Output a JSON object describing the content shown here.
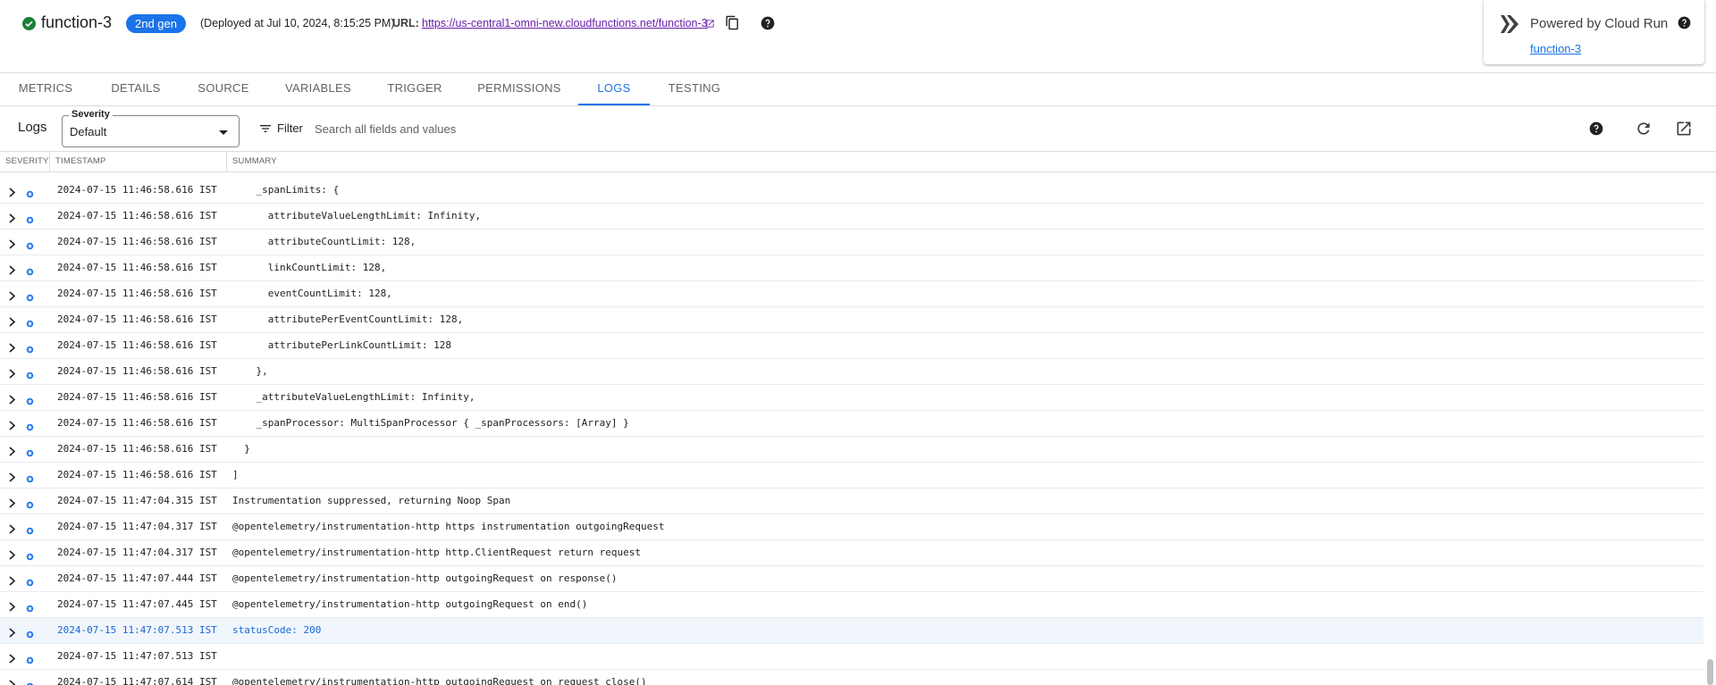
{
  "header": {
    "function_name": "function-3",
    "gen_badge": "2nd gen",
    "deployed": "(Deployed at Jul 10, 2024, 8:15:25 PM)",
    "url_label": "URL:",
    "url": "https://us-central1-omni-new.cloudfunctions.net/function-3"
  },
  "cloud_run": {
    "title": "Powered by Cloud Run",
    "link": "function-3"
  },
  "tabs": [
    {
      "label": "METRICS",
      "active": false
    },
    {
      "label": "DETAILS",
      "active": false
    },
    {
      "label": "SOURCE",
      "active": false
    },
    {
      "label": "VARIABLES",
      "active": false
    },
    {
      "label": "TRIGGER",
      "active": false
    },
    {
      "label": "PERMISSIONS",
      "active": false
    },
    {
      "label": "LOGS",
      "active": true
    },
    {
      "label": "TESTING",
      "active": false
    }
  ],
  "toolbar": {
    "title": "Logs",
    "severity_label": "Severity",
    "severity_value": "Default",
    "filter_label": "Filter",
    "search_placeholder": "Search all fields and values"
  },
  "table": {
    "columns": {
      "severity": "SEVERITY",
      "timestamp": "TIMESTAMP",
      "summary": "SUMMARY"
    },
    "rows": [
      {
        "ts": "2024-07-15 11:46:58.616 IST",
        "msg": "    _spanLimits: {",
        "highlight": false
      },
      {
        "ts": "2024-07-15 11:46:58.616 IST",
        "msg": "      attributeValueLengthLimit: Infinity,",
        "highlight": false
      },
      {
        "ts": "2024-07-15 11:46:58.616 IST",
        "msg": "      attributeCountLimit: 128,",
        "highlight": false
      },
      {
        "ts": "2024-07-15 11:46:58.616 IST",
        "msg": "      linkCountLimit: 128,",
        "highlight": false
      },
      {
        "ts": "2024-07-15 11:46:58.616 IST",
        "msg": "      eventCountLimit: 128,",
        "highlight": false
      },
      {
        "ts": "2024-07-15 11:46:58.616 IST",
        "msg": "      attributePerEventCountLimit: 128,",
        "highlight": false
      },
      {
        "ts": "2024-07-15 11:46:58.616 IST",
        "msg": "      attributePerLinkCountLimit: 128",
        "highlight": false
      },
      {
        "ts": "2024-07-15 11:46:58.616 IST",
        "msg": "    },",
        "highlight": false
      },
      {
        "ts": "2024-07-15 11:46:58.616 IST",
        "msg": "    _attributeValueLengthLimit: Infinity,",
        "highlight": false
      },
      {
        "ts": "2024-07-15 11:46:58.616 IST",
        "msg": "    _spanProcessor: MultiSpanProcessor { _spanProcessors: [Array] }",
        "highlight": false
      },
      {
        "ts": "2024-07-15 11:46:58.616 IST",
        "msg": "  }",
        "highlight": false
      },
      {
        "ts": "2024-07-15 11:46:58.616 IST",
        "msg": "]",
        "highlight": false
      },
      {
        "ts": "2024-07-15 11:47:04.315 IST",
        "msg": "Instrumentation suppressed, returning Noop Span",
        "highlight": false
      },
      {
        "ts": "2024-07-15 11:47:04.317 IST",
        "msg": "@opentelemetry/instrumentation-http https instrumentation outgoingRequest",
        "highlight": false
      },
      {
        "ts": "2024-07-15 11:47:04.317 IST",
        "msg": "@opentelemetry/instrumentation-http http.ClientRequest return request",
        "highlight": false
      },
      {
        "ts": "2024-07-15 11:47:07.444 IST",
        "msg": "@opentelemetry/instrumentation-http outgoingRequest on response()",
        "highlight": false
      },
      {
        "ts": "2024-07-15 11:47:07.445 IST",
        "msg": "@opentelemetry/instrumentation-http outgoingRequest on end()",
        "highlight": false
      },
      {
        "ts": "2024-07-15 11:47:07.513 IST",
        "msg": "statusCode: 200",
        "highlight": true
      },
      {
        "ts": "2024-07-15 11:47:07.513 IST",
        "msg": "",
        "highlight": false
      },
      {
        "ts": "2024-07-15 11:47:07.614 IST",
        "msg": "@opentelemetry/instrumentation-http outgoingRequest on request close()",
        "highlight": false
      }
    ]
  },
  "colors": {
    "accent": "#1a73e8",
    "success": "#188038",
    "link_visited": "#681da8",
    "severity_default": "#1a73e8"
  },
  "icons": {
    "status": "check-circle-icon",
    "external": "open-in-new-icon",
    "copy": "copy-icon",
    "help": "help-icon",
    "cloud_run": "cloud-run-logo-icon",
    "filter": "filter-icon",
    "refresh": "refresh-icon",
    "open": "open-in-new-icon",
    "expand": "chevron-right-icon",
    "severity": "asterisk-icon"
  }
}
